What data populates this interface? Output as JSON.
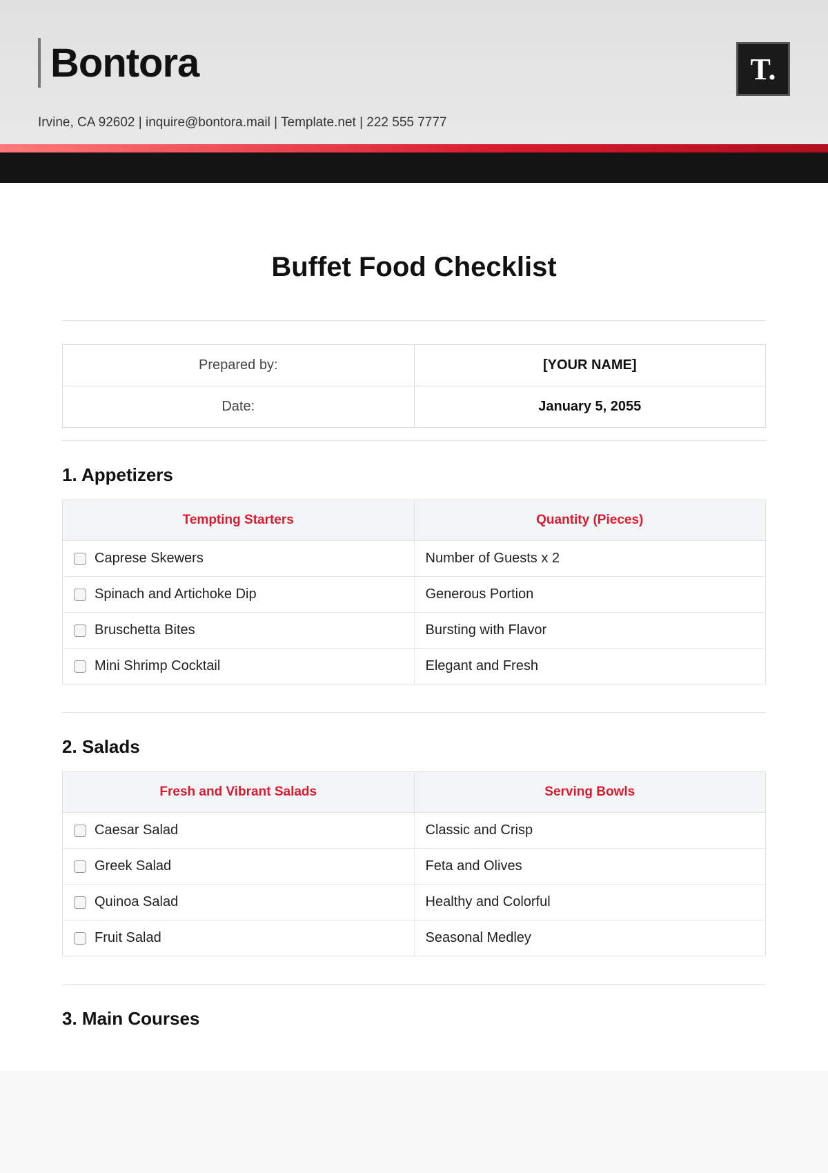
{
  "header": {
    "brand": "Bontora",
    "logo_text": "T.",
    "contact": "Irvine, CA 92602 | inquire@bontora.mail | Template.net | 222 555 7777"
  },
  "document": {
    "title": "Buffet Food Checklist"
  },
  "meta": {
    "prepared_label": "Prepared by:",
    "prepared_value": "[YOUR NAME]",
    "date_label": "Date:",
    "date_value": "January 5, 2055"
  },
  "sections": [
    {
      "title": "1. Appetizers",
      "col1": "Tempting Starters",
      "col2": "Quantity (Pieces)",
      "rows": [
        {
          "item": "Caprese Skewers",
          "qty": "Number of Guests x 2"
        },
        {
          "item": "Spinach and Artichoke Dip",
          "qty": "Generous Portion"
        },
        {
          "item": "Bruschetta Bites",
          "qty": "Bursting with Flavor"
        },
        {
          "item": "Mini Shrimp Cocktail",
          "qty": "Elegant and Fresh"
        }
      ]
    },
    {
      "title": "2. Salads",
      "col1": "Fresh and Vibrant Salads",
      "col2": "Serving Bowls",
      "rows": [
        {
          "item": "Caesar Salad",
          "qty": "Classic and Crisp"
        },
        {
          "item": "Greek Salad",
          "qty": "Feta and Olives"
        },
        {
          "item": "Quinoa Salad",
          "qty": "Healthy and Colorful"
        },
        {
          "item": "Fruit Salad",
          "qty": "Seasonal Medley"
        }
      ]
    },
    {
      "title": "3. Main Courses",
      "col1": "",
      "col2": "",
      "rows": []
    }
  ]
}
